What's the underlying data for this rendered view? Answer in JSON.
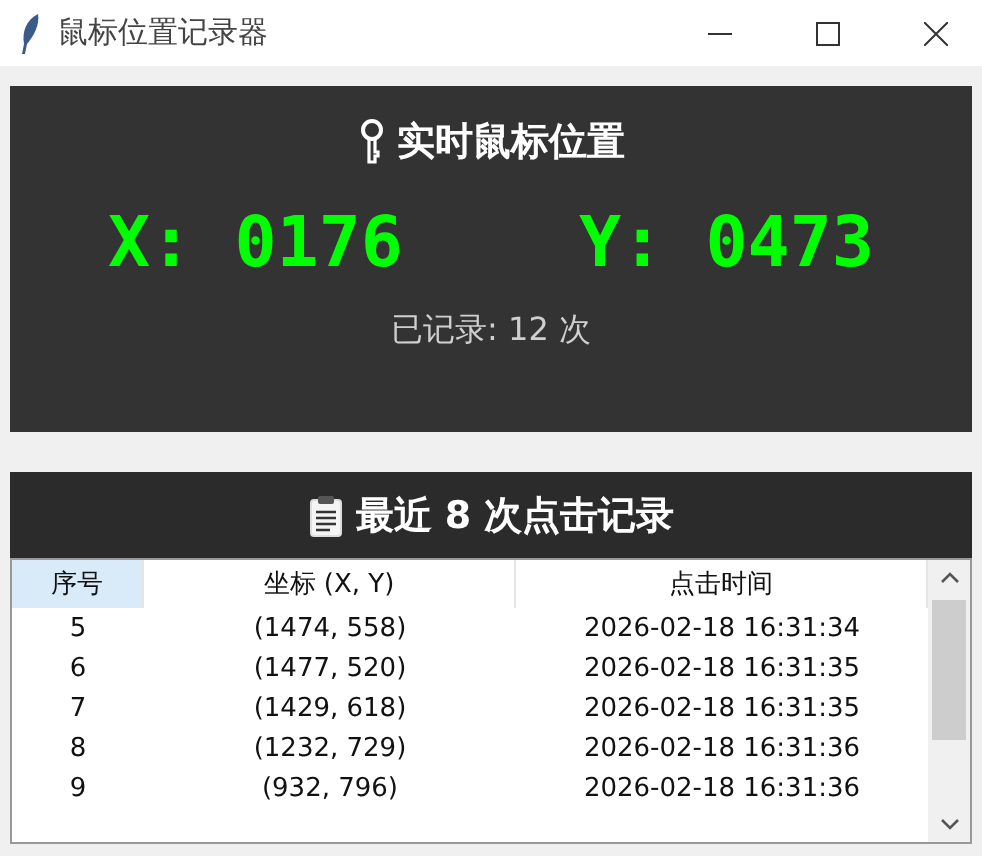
{
  "window": {
    "title": "鼠标位置记录器"
  },
  "live_panel": {
    "title": "实时鼠标位置",
    "x_label": "X:",
    "x_value": "0176",
    "y_label": "Y:",
    "y_value": "0473",
    "recorded": "已记录: 12 次"
  },
  "history_panel": {
    "title": "最近 8 次点击记录"
  },
  "table": {
    "columns": [
      {
        "label": "序号",
        "hovered": true
      },
      {
        "label": "坐标 (X, Y)",
        "hovered": false
      },
      {
        "label": "点击时间",
        "hovered": false
      }
    ],
    "rows": [
      {
        "index": "5",
        "coords": "(1474, 558)",
        "time": "2026-02-18 16:31:34"
      },
      {
        "index": "6",
        "coords": "(1477, 520)",
        "time": "2026-02-18 16:31:35"
      },
      {
        "index": "7",
        "coords": "(1429, 618)",
        "time": "2026-02-18 16:31:35"
      },
      {
        "index": "8",
        "coords": "(1232, 729)",
        "time": "2026-02-18 16:31:36"
      },
      {
        "index": "9",
        "coords": "(932, 796)",
        "time": "2026-02-18 16:31:36"
      }
    ]
  }
}
